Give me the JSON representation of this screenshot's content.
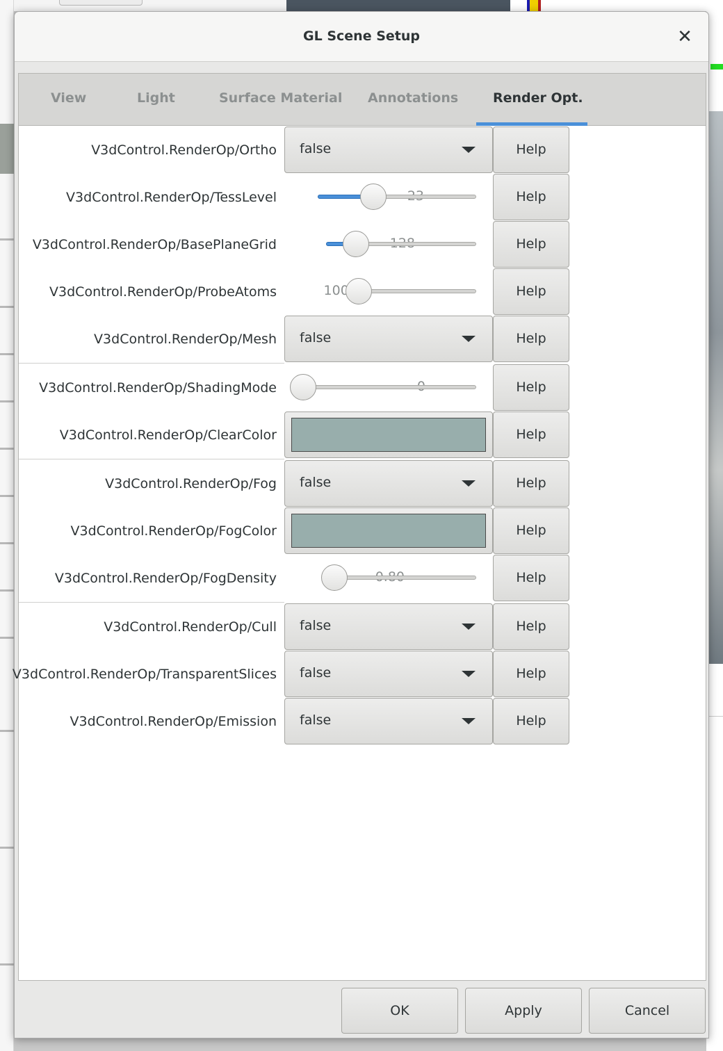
{
  "dialog": {
    "title": "GL Scene Setup",
    "close_icon": "close-icon"
  },
  "tabs": [
    {
      "label": "View",
      "active": false
    },
    {
      "label": "Light",
      "active": false
    },
    {
      "label": "Surface Material",
      "active": false
    },
    {
      "label": "Annotations",
      "active": false
    },
    {
      "label": "Render Opt.",
      "active": true
    }
  ],
  "rows": [
    {
      "label": "V3dControl.RenderOp/Ortho",
      "kind": "combo",
      "value": "false",
      "help": "Help"
    },
    {
      "label": "V3dControl.RenderOp/TessLevel",
      "kind": "scale",
      "value": "23",
      "fraction": 0.35,
      "help": "Help"
    },
    {
      "label": "V3dControl.RenderOp/BasePlaneGrid",
      "kind": "scale",
      "value": "128",
      "fraction": 0.2,
      "help": "Help"
    },
    {
      "label": "V3dControl.RenderOp/ProbeAtoms",
      "kind": "scale",
      "value": "1000.0",
      "fraction": 0.0,
      "help": "Help"
    },
    {
      "label": "V3dControl.RenderOp/Mesh",
      "kind": "combo",
      "value": "false",
      "help": "Help"
    },
    {
      "label": "V3dControl.RenderOp/ShadingMode",
      "kind": "scale",
      "value": "0",
      "fraction": 0.0,
      "help": "Help"
    },
    {
      "label": "V3dControl.RenderOp/ClearColor",
      "kind": "color",
      "color": "#98aeac",
      "help": "Help"
    },
    {
      "label": "V3dControl.RenderOp/Fog",
      "kind": "combo",
      "value": "false",
      "help": "Help"
    },
    {
      "label": "V3dControl.RenderOp/FogColor",
      "kind": "color",
      "color": "#98aeac",
      "help": "Help"
    },
    {
      "label": "V3dControl.RenderOp/FogDensity",
      "kind": "scale",
      "value": "0.80",
      "fraction": 0.0,
      "help": "Help"
    },
    {
      "label": "V3dControl.RenderOp/Cull",
      "kind": "combo",
      "value": "false",
      "help": "Help"
    },
    {
      "label": "V3dControl.RenderOp/TransparentSlices",
      "kind": "combo",
      "value": "false",
      "help": "Help"
    },
    {
      "label": "V3dControl.RenderOp/Emission",
      "kind": "combo",
      "value": "false",
      "help": "Help"
    }
  ],
  "buttons": {
    "ok": "OK",
    "apply": "Apply",
    "cancel": "Cancel"
  },
  "colors": {
    "accent": "#4a90d9",
    "swatch": "#98aeac"
  }
}
